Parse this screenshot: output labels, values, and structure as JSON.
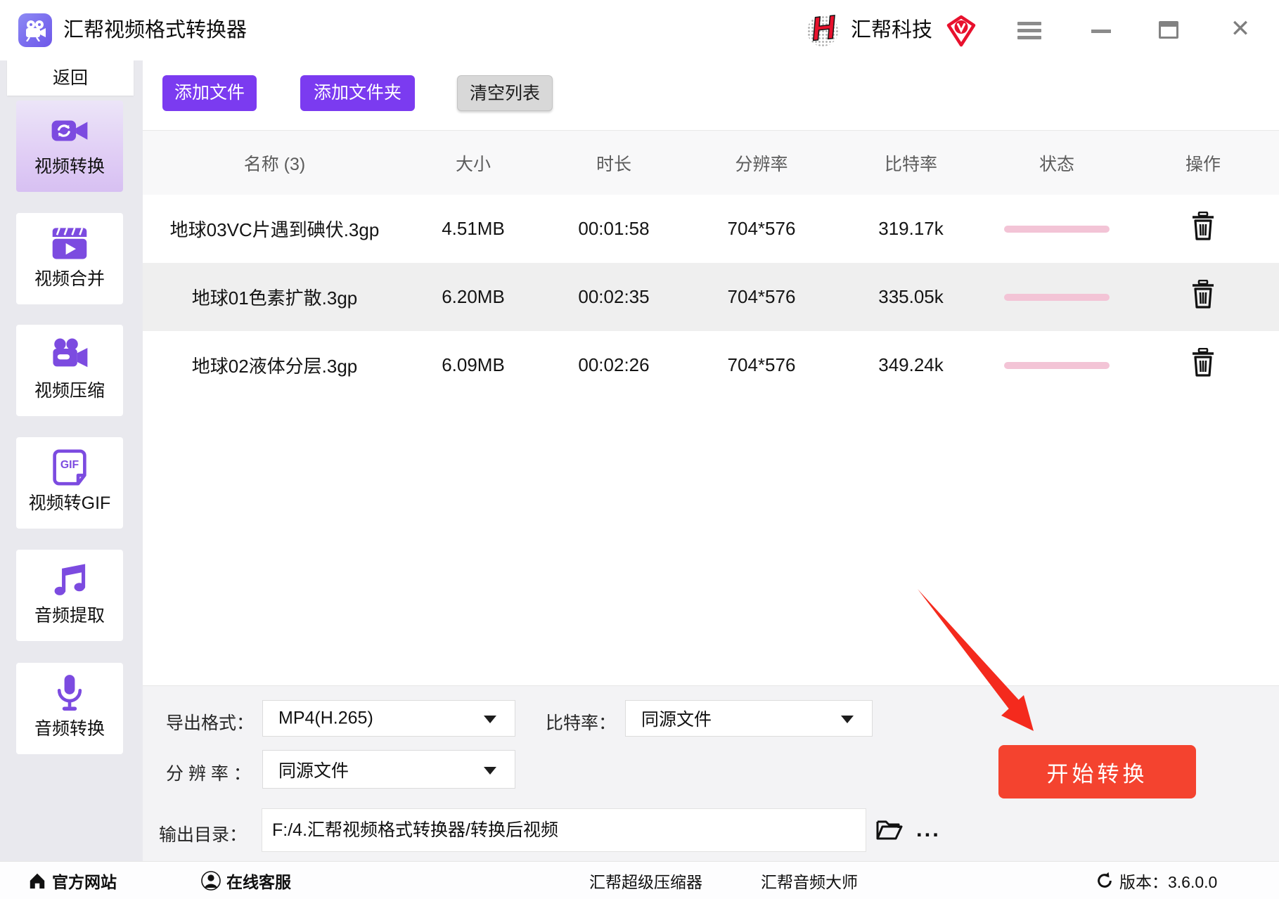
{
  "titlebar": {
    "app_title": "汇帮视频格式转换器",
    "brand_h": "H",
    "brand_name": "汇帮科技",
    "close_glyph": "✕"
  },
  "sidebar": {
    "back": "返回",
    "items": [
      {
        "label": "视频转换",
        "active": true
      },
      {
        "label": "视频合并",
        "active": false
      },
      {
        "label": "视频压缩",
        "active": false
      },
      {
        "label": "视频转GIF",
        "active": false
      },
      {
        "label": "音频提取",
        "active": false
      },
      {
        "label": "音频转换",
        "active": false
      }
    ]
  },
  "toolbar": {
    "add_file": "添加文件",
    "add_folder": "添加文件夹",
    "clear_list": "清空列表"
  },
  "table": {
    "headers": [
      "名称 (3)",
      "大小",
      "时长",
      "分辨率",
      "比特率",
      "状态",
      "操作"
    ],
    "rows": [
      {
        "name": "地球03VC片遇到碘伏.3gp",
        "size": "4.51MB",
        "duration": "00:01:58",
        "resolution": "704*576",
        "bitrate": "319.17k"
      },
      {
        "name": "地球01色素扩散.3gp",
        "size": "6.20MB",
        "duration": "00:02:35",
        "resolution": "704*576",
        "bitrate": "335.05k"
      },
      {
        "name": "地球02液体分层.3gp",
        "size": "6.09MB",
        "duration": "00:02:26",
        "resolution": "704*576",
        "bitrate": "349.24k"
      }
    ]
  },
  "settings": {
    "export_format_label": "导出格式：",
    "export_format_value": "MP4(H.265)",
    "bitrate_label": "比特率：",
    "bitrate_value": "同源文件",
    "resolution_label": "分 辨 率 ：",
    "resolution_value": "同源文件",
    "output_dir_label": "输出目录：",
    "output_dir_value": "F:/4.汇帮视频格式转换器/转换后视频",
    "more_button": "...",
    "start_button": "开始转换"
  },
  "footer": {
    "official_site": "官方网站",
    "online_service": "在线客服",
    "link_compressor": "汇帮超级压缩器",
    "link_audio_master": "汇帮音频大师",
    "version": "版本：3.6.0.0"
  },
  "colors": {
    "accent_purple": "#7b3bf0",
    "icon_purple": "#7c4be0",
    "brand_red": "#e8112d",
    "start_red": "#f4432f",
    "progress_pink": "#f3c4d6",
    "sidebar_gray": "#e9e9ee"
  }
}
